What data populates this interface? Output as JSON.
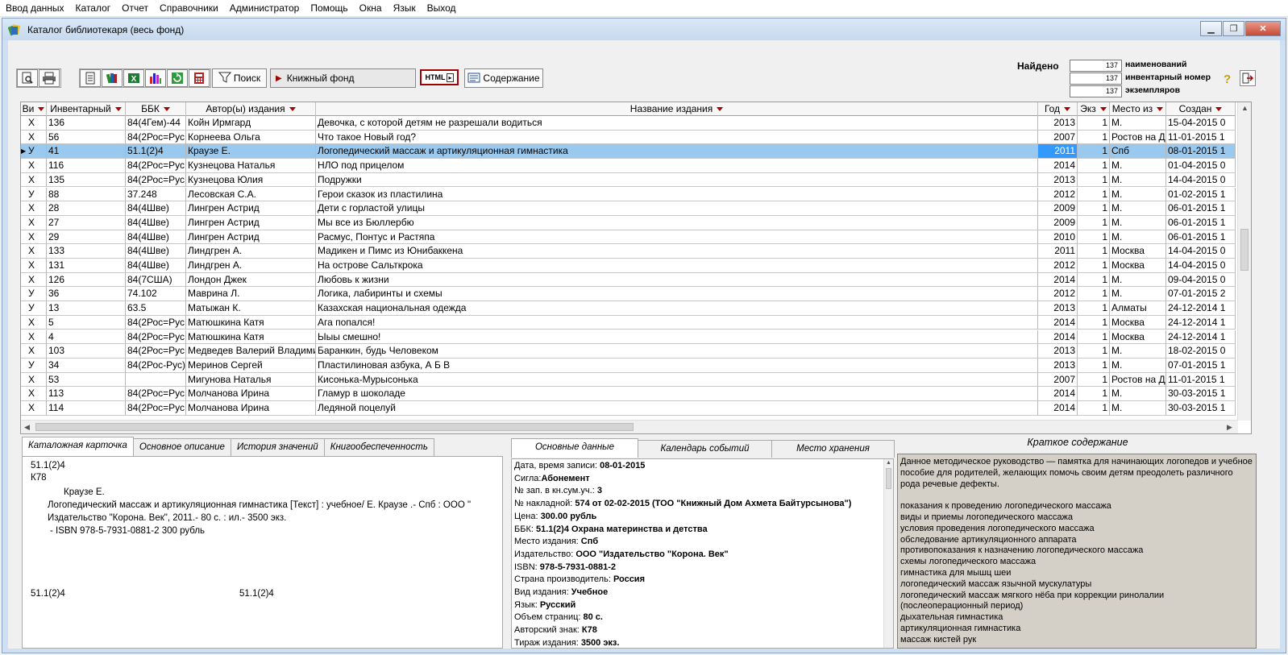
{
  "menu": [
    "Ввод данных",
    "Каталог",
    "Отчет",
    "Справочники",
    "Администратор",
    "Помощь",
    "Окна",
    "Язык",
    "Выход"
  ],
  "window": {
    "title": "Каталог библиотекаря (весь фонд)"
  },
  "toolbar": {
    "search_label": "Поиск",
    "fund_label": "Книжный фонд",
    "html_label": "HTML",
    "contents_label": "Содержание"
  },
  "found": {
    "label": "Найдено",
    "titles_count": "137",
    "titles_caption": "наименований",
    "inventory_count": "137",
    "inventory_caption": "инвентарный номер",
    "copies_count": "137",
    "copies_caption": "экземпляров"
  },
  "grid": {
    "headers": [
      "Ви",
      "Инвентарный",
      "ББК",
      "Автор(ы) издания",
      "Название издания",
      "Год",
      "Экз",
      "Место из",
      "Создан"
    ],
    "rows": [
      [
        "Х",
        "136",
        "84(4Гем)-44",
        "Койн Ирмгард",
        "Девочка, с которой детям не разрешали водиться",
        "2013",
        "1",
        "М.",
        "15-04-2015 0"
      ],
      [
        "Х",
        "56",
        "84(2Рос=Рус",
        "Корнеева Ольга",
        "Что такое Новый год?",
        "2007",
        "1",
        "Ростов на Д",
        "11-01-2015 1"
      ],
      [
        "У",
        "41",
        "51.1(2)4",
        "Краузе Е.",
        "Логопедический массаж и артикуляционная гимнастика",
        "2011",
        "1",
        "Спб",
        "08-01-2015 1"
      ],
      [
        "Х",
        "116",
        "84(2Рос=Рус",
        "Кузнецова Наталья",
        "НЛО под прицелом",
        "2014",
        "1",
        "М.",
        "01-04-2015 0"
      ],
      [
        "Х",
        "135",
        "84(2Рос=Рус",
        "Кузнецова Юлия",
        "Подружки",
        "2013",
        "1",
        "М.",
        "14-04-2015 0"
      ],
      [
        "У",
        "88",
        "37.248",
        "Лесовская С.А.",
        "Герои сказок из пластилина",
        "2012",
        "1",
        "М.",
        "01-02-2015 1"
      ],
      [
        "Х",
        "28",
        "84(4Шве)",
        "Лингрен Астрид",
        "Дети с горластой улицы",
        "2009",
        "1",
        "М.",
        "06-01-2015 1"
      ],
      [
        "Х",
        "27",
        "84(4Шве)",
        "Лингрен Астрид",
        "Мы все из Бюллербю",
        "2009",
        "1",
        "М.",
        "06-01-2015 1"
      ],
      [
        "Х",
        "29",
        "84(4Шве)",
        "Лингрен Астрид",
        "Расмус, Понтус и Растяпа",
        "2010",
        "1",
        "М.",
        "06-01-2015 1"
      ],
      [
        "Х",
        "133",
        "84(4Шве)",
        "Линдгрен А.",
        "Мадикен и Пимс из Юнибаккена",
        "2011",
        "1",
        "Москва",
        "14-04-2015 0"
      ],
      [
        "Х",
        "131",
        "84(4Шве)",
        "Линдгрен А.",
        "На острове Сальткрока",
        "2012",
        "1",
        "Москва",
        "14-04-2015 0"
      ],
      [
        "Х",
        "126",
        "84(7США)",
        "Лондон Джек",
        "Любовь к жизни",
        "2014",
        "1",
        "М.",
        "09-04-2015 0"
      ],
      [
        "У",
        "36",
        "74.102",
        "Маврина Л.",
        "Логика, лабиринты и схемы",
        "2012",
        "1",
        "М.",
        "07-01-2015 2"
      ],
      [
        "У",
        "13",
        "63.5",
        "Матыжан К.",
        "Казахская национальная одежда",
        "2013",
        "1",
        "Алматы",
        "24-12-2014 1"
      ],
      [
        "Х",
        "5",
        "84(2Рос=Рус",
        "Матюшкина Катя",
        "Ага попался!",
        "2014",
        "1",
        "Москва",
        "24-12-2014 1"
      ],
      [
        "Х",
        "4",
        "84(2Рос=Рус",
        "Матюшкина Катя",
        "Ыыы смешно!",
        "2014",
        "1",
        "Москва",
        "24-12-2014 1"
      ],
      [
        "Х",
        "103",
        "84(2Рос=Рус",
        "Медведев Валерий Владими",
        "Баранкин, будь Человеком",
        "2013",
        "1",
        "М.",
        "18-02-2015 0"
      ],
      [
        "У",
        "34",
        "84(2Рос-Рус)",
        "Меринов Сергей",
        "Пластилиновая азбука, А Б В",
        "2013",
        "1",
        "М.",
        "07-01-2015 1"
      ],
      [
        "Х",
        "53",
        "",
        "Мигунова Наталья",
        "Кисонька-Мурысонька",
        "2007",
        "1",
        "Ростов на Д",
        "11-01-2015 1"
      ],
      [
        "Х",
        "113",
        "84(2Рос=Рус",
        "Молчанова Ирина",
        "Гламур в шоколаде",
        "2014",
        "1",
        "М.",
        "30-03-2015 1"
      ],
      [
        "Х",
        "114",
        "84(2Рос=Рус",
        "Молчанова Ирина",
        "Ледяной поцелуй",
        "2014",
        "1",
        "М.",
        "30-03-2015 1"
      ]
    ]
  },
  "card_tabs": [
    "Каталожная карточка",
    "Основное описание",
    "История значений",
    "Книгообеспеченность"
  ],
  "card": {
    "bbk": "51.1(2)4",
    "author_mark": "К78",
    "author": "Краузе Е.",
    "line1": "Логопедический массаж и артикуляционная гимнастика [Текст] : учебное/ Е. Краузе .- Спб : ООО \"",
    "line2": "Издательство \"Корона. Век\", 2011.- 80 с. : ил.- 3500 экз.",
    "line3": "- ISBN 978-5-7931-0881-2 300 рубль",
    "footer_left": "51.1(2)4",
    "footer_right": "51.1(2)4"
  },
  "main_tabs": [
    "Основные данные",
    "Календарь событий",
    "Место хранения"
  ],
  "main_data": [
    {
      "label": "Дата, время записи: ",
      "value": "08-01-2015"
    },
    {
      "label": "Сигла:",
      "value": "Абонемент"
    },
    {
      "label": "№ зап. в кн.сум.уч.: ",
      "value": "3"
    },
    {
      "label": "№ накладной: ",
      "value": "574 от 02-02-2015 (ТОО \"Книжный Дом Ахмета Байтурсынова\")"
    },
    {
      "label": "Цена: ",
      "value": "300.00 рубль"
    },
    {
      "label": "ББК: ",
      "value": "51.1(2)4 Охрана материнства и детства"
    },
    {
      "label": "Место издания: ",
      "value": "Спб"
    },
    {
      "label": "Издательство: ",
      "value": "ООО \"Издательство \"Корона. Век\""
    },
    {
      "label": "ISBN: ",
      "value": "978-5-7931-0881-2"
    },
    {
      "label": "Страна производитель: ",
      "value": "Россия"
    },
    {
      "label": "Вид издания: ",
      "value": "Учебное"
    },
    {
      "label": "Язык: ",
      "value": "Русский"
    },
    {
      "label": "Объем страниц: ",
      "value": "80 с."
    },
    {
      "label": "Авторский знак: ",
      "value": "К78"
    },
    {
      "label": "Тираж издания: ",
      "value": "3500 экз."
    }
  ],
  "summary": {
    "title": "Краткое содержание",
    "intro": "Данное методическое руководство — памятка для начинающих логопедов и учебное пособие для родителей, желающих помочь своим детям преодолеть различного рода речевые дефекты.",
    "items": [
      "показания к проведению логопедического массажа",
      "виды и приемы логопедического массажа",
      "условия проведения логопедического массажа",
      "обследование артикуляционного аппарата",
      "противопоказания к назначению  логопедического массажа",
      "схемы логопедического массажа",
      "гимнастика для мышц шеи",
      "логопедический массаж язычной мускулатуры",
      "логопедический массаж мягкого нёба при коррекции ринолалии (послеоперационный период)",
      "дыхательная гимнастика",
      "артикуляционная гимнастика",
      "массаж кистей рук"
    ]
  },
  "colors": {
    "selection": "#99c9ef",
    "selection_focus": "#3399ff",
    "sort_arrow": "#a00000",
    "summary_bg": "#d4d0c8"
  }
}
